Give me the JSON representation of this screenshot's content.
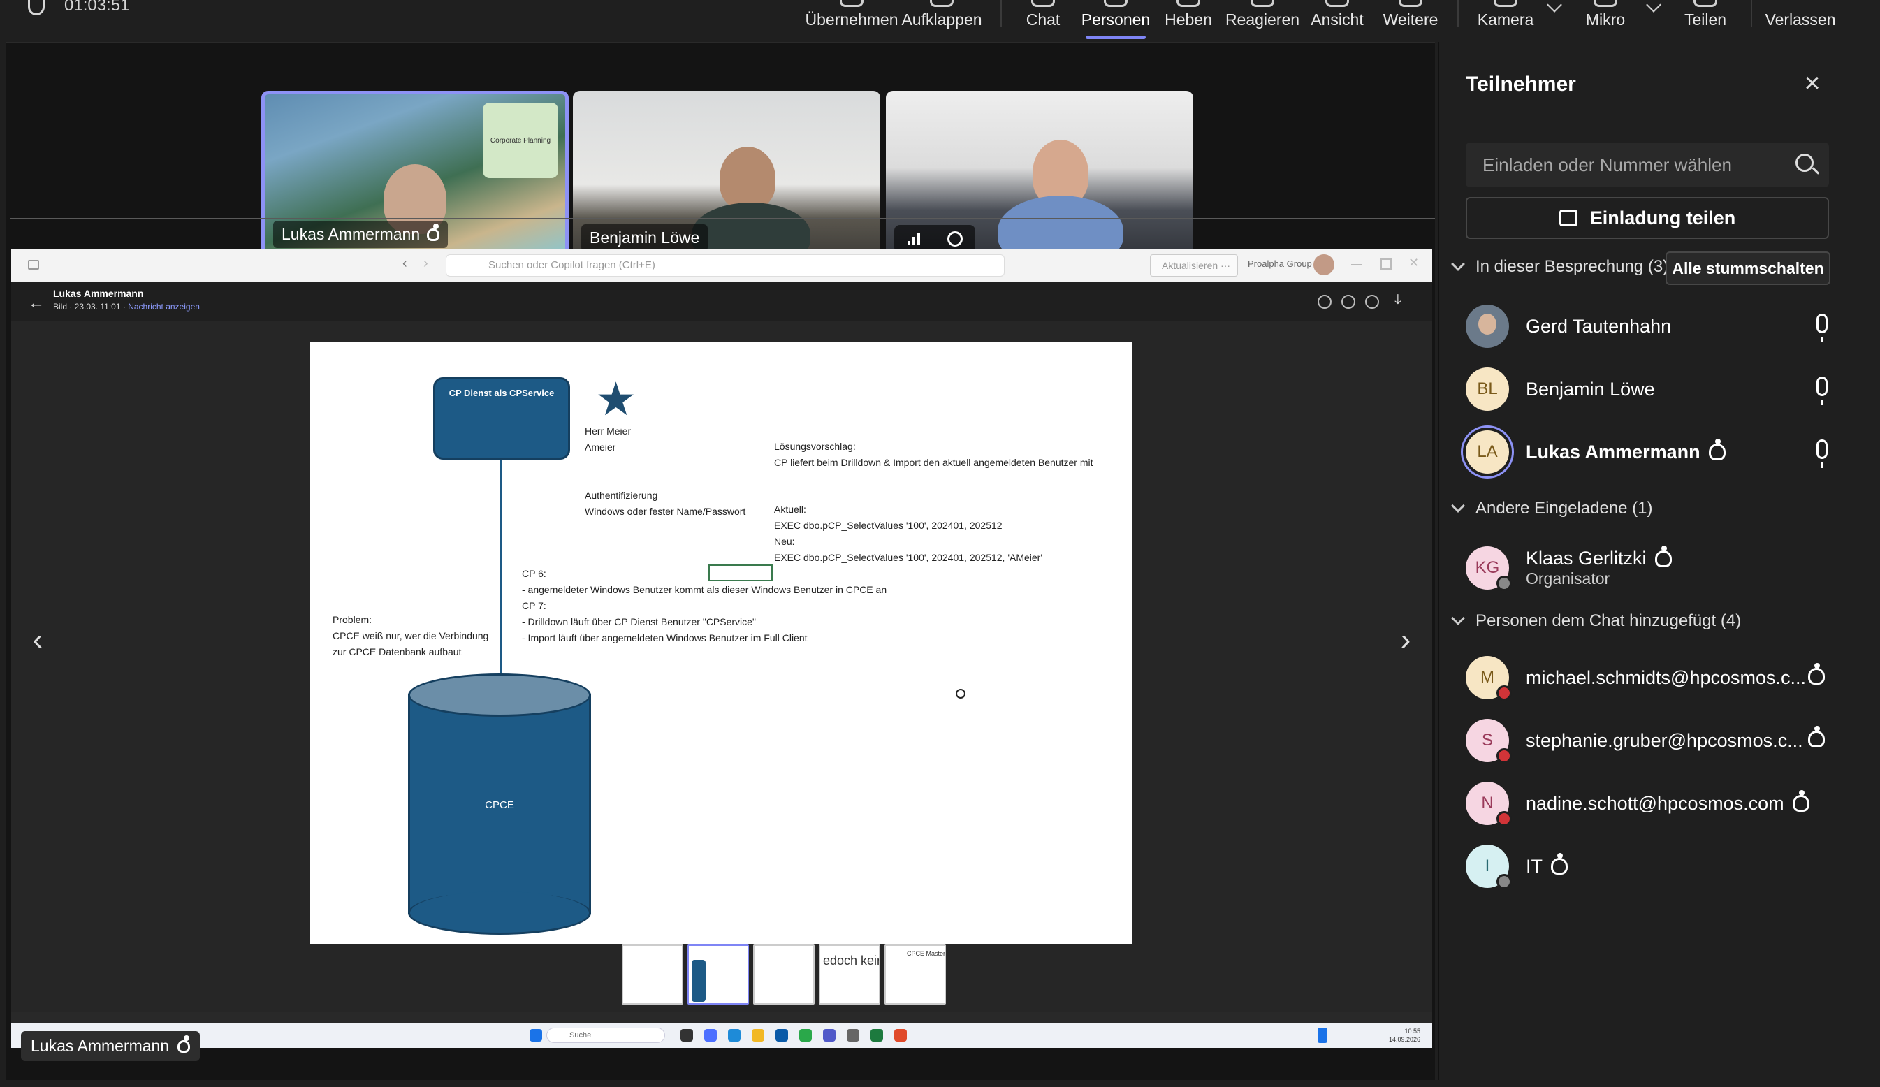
{
  "meeting": {
    "timer": "01:03:51",
    "toolbar": [
      {
        "id": "takeover",
        "label": "Übernehmen"
      },
      {
        "id": "expand",
        "label": "Aufklappen"
      },
      {
        "id": "chat",
        "label": "Chat"
      },
      {
        "id": "people",
        "label": "Personen",
        "active": true
      },
      {
        "id": "raise",
        "label": "Heben"
      },
      {
        "id": "react",
        "label": "Reagieren"
      },
      {
        "id": "view",
        "label": "Ansicht"
      },
      {
        "id": "more",
        "label": "Weitere"
      },
      {
        "id": "camera",
        "label": "Kamera"
      },
      {
        "id": "mic",
        "label": "Mikro"
      },
      {
        "id": "share",
        "label": "Teilen"
      },
      {
        "id": "leave",
        "label": "Verlassen"
      }
    ]
  },
  "video_tiles": [
    {
      "name": "Lukas Ammermann",
      "slide_card": "Corporate Planning"
    },
    {
      "name": "Benjamin Löwe"
    },
    {
      "name": ""
    }
  ],
  "shared_screen": {
    "presenter_label": "Lukas Ammermann",
    "browser": {
      "search_placeholder": "Suchen oder Copilot fragen (Ctrl+E)",
      "refresh_label": "Aktualisieren ···",
      "org_label": "Proalpha Group"
    },
    "viewer": {
      "sender": "Lukas Ammermann",
      "meta": "Bild · 23.03. 11:01 · ",
      "link": "Nachricht anzeigen"
    },
    "slide": {
      "cp_box": "CP Dienst als CPService",
      "user_name": "Herr Meier\nAmeier",
      "auth": "Authentifizierung\nWindows oder fester Name/Passwort",
      "proposal": "Lösungsvorschlag:\nCP liefert beim Drilldown & Import den aktuell angemeldeten Benutzer mit",
      "current": "Aktuell:\nEXEC dbo.pCP_SelectValues '100', 202401, 202512\nNeu:\nEXEC dbo.pCP_SelectValues '100', 202401, 202512, 'AMeier'",
      "cp6": "CP 6:\n- angemeldeter Windows Benutzer kommt als dieser Windows Benutzer in CPCE an\nCP 7:\n- Drilldown läuft über CP Dienst Benutzer \"CPService\"\n- Import läuft über angemeldeten Windows Benutzer im Full Client",
      "problem": "Problem:\nCPCE weiß nur, wer die Verbindung\nzur CPCE Datenbank aufbaut",
      "cylinder": "CPCE"
    },
    "thumbnails": [
      {
        "text": ""
      },
      {
        "text": ""
      },
      {
        "text": ""
      },
      {
        "text": "edoch kein\nrte ConBI b"
      },
      {
        "text": "CPCE\nMaster"
      }
    ],
    "taskbar": {
      "search": "Suche",
      "time": "10:55",
      "date": "14.09.2026"
    }
  },
  "panel": {
    "title": "Teilnehmer",
    "invite_placeholder": "Einladen oder Nummer wählen",
    "share_invite": "Einladung teilen",
    "mute_all": "Alle stummschalten",
    "sections": {
      "in_meeting": "In dieser Besprechung (3)",
      "invited": "Andere Eingeladene (1)",
      "chat_added": "Personen dem Chat hinzugefügt (4)"
    },
    "in_meeting": [
      {
        "name": "Gerd Tautenhahn",
        "initials": "",
        "color": "#6b7a8a"
      },
      {
        "name": "Benjamin Löwe",
        "initials": "BL",
        "color": "#f7e6c4",
        "text_color": "#7a5a1a"
      },
      {
        "name": "Lukas Ammermann",
        "initials": "LA",
        "color": "#f7e6c4",
        "text_color": "#7a5a1a"
      }
    ],
    "invited": [
      {
        "name": "Klaas Gerlitzki",
        "role": "Organisator",
        "initials": "KG",
        "color": "#f6d6e2",
        "text_color": "#9a3a5a"
      }
    ],
    "chat_added": [
      {
        "name": "michael.schmidts@hpcosmos.c...",
        "initials": "M",
        "color": "#f7e6c4",
        "text_color": "#7a5a1a"
      },
      {
        "name": "stephanie.gruber@hpcosmos.c...",
        "initials": "S",
        "color": "#f6d6e2",
        "text_color": "#9a3a5a"
      },
      {
        "name": "nadine.schott@hpcosmos.com",
        "initials": "N",
        "color": "#f6d6e2",
        "text_color": "#9a3a5a"
      },
      {
        "name": "IT",
        "initials": "I",
        "color": "#d6f0f2",
        "text_color": "#2a6a72"
      }
    ]
  }
}
